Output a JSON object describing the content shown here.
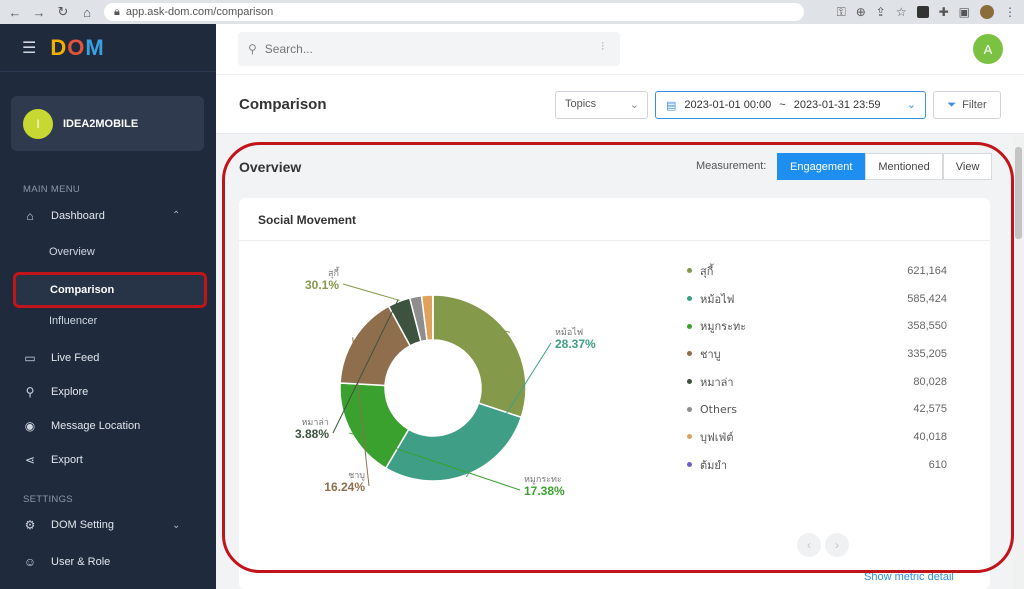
{
  "browser": {
    "url": "app.ask-dom.com/comparison"
  },
  "sidebar": {
    "logo": [
      "D",
      "O",
      "M"
    ],
    "org": {
      "initial": "I",
      "name": "IDEA2MOBILE"
    },
    "main_menu_title": "MAIN MENU",
    "dashboard_label": "Dashboard",
    "sub_items": {
      "overview": "Overview",
      "comparison": "Comparison",
      "influencer": "Influencer"
    },
    "items": {
      "live_feed": "Live Feed",
      "explore": "Explore",
      "message_location": "Message Location",
      "export": "Export"
    },
    "settings_title": "SETTINGS",
    "dom_setting": "DOM Setting",
    "user_role": "User & Role"
  },
  "topbar": {
    "search_placeholder": "Search...",
    "user_initial": "A"
  },
  "header": {
    "title": "Comparison",
    "topics_label": "Topics",
    "date_start": "2023-01-01 00:00",
    "date_sep": "~",
    "date_end": "2023-01-31 23:59",
    "filter_label": "Filter"
  },
  "overview": {
    "title": "Overview",
    "measurement_label": "Measurement:",
    "buttons": {
      "engagement": "Engagement",
      "mentioned": "Mentioned",
      "view": "View"
    },
    "card_title": "Social Movement",
    "show_metric": "Show metric detail"
  },
  "chart_data": {
    "type": "pie",
    "donut": true,
    "categories": [
      "สุกี้",
      "หม้อไฟ",
      "หมูกระทะ",
      "ชาบู",
      "หมาล่า",
      "Others",
      "บุฟเฟ่ต์",
      "ต้มยำ"
    ],
    "values": [
      621164,
      585424,
      358550,
      335205,
      80028,
      42575,
      40018,
      610
    ],
    "value_labels": [
      "621,164",
      "585,424",
      "358,550",
      "335,205",
      "80,028",
      "42,575",
      "40,018",
      "610"
    ],
    "percent_labels": {
      "สุกี้": "30.1%",
      "หม้อไฟ": "28.37%",
      "หมูกระทะ": "17.38%",
      "ชาบู": "16.24%",
      "หมาล่า": "3.88%"
    },
    "colors": [
      "#84994a",
      "#3f9f86",
      "#3aa02e",
      "#8f6e4d",
      "#3d5340",
      "#8e8e8e",
      "#e0a15c",
      "#6c63c9"
    ],
    "legend": "right"
  }
}
